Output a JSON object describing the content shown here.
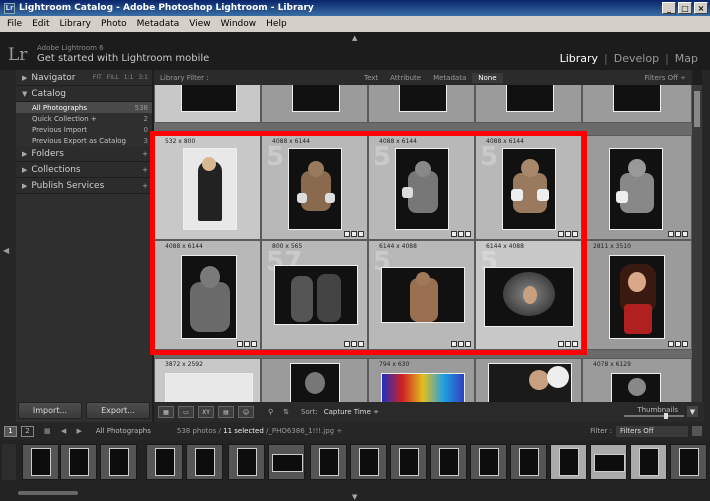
{
  "window": {
    "title": "Lightroom Catalog - Adobe Photoshop Lightroom - Library",
    "app_icon": "Lr",
    "min": "_",
    "max": "□",
    "close": "×"
  },
  "menu": [
    "File",
    "Edit",
    "Library",
    "Photo",
    "Metadata",
    "View",
    "Window",
    "Help"
  ],
  "identity": {
    "logo": "Lr",
    "brand": "Adobe Lightroom 6",
    "mobile": "Get started with Lightroom mobile"
  },
  "modules": {
    "library": "Library",
    "develop": "Develop",
    "map": "Map",
    "sep": "|"
  },
  "left_panel": {
    "navigator": {
      "label": "Navigator",
      "fit": "FIT",
      "fill": "FILL",
      "one": "1:1",
      "three": "3:1"
    },
    "catalog": {
      "label": "Catalog",
      "items": [
        {
          "label": "All Photographs",
          "count": "538"
        },
        {
          "label": "Quick Collection +",
          "count": "2"
        },
        {
          "label": "Previous Import",
          "count": "0"
        },
        {
          "label": "Previous Export as Catalog",
          "count": "3"
        }
      ]
    },
    "folders": "Folders",
    "collections": "Collections",
    "publish": "Publish Services",
    "plus": "+",
    "import": "Import...",
    "export": "Export..."
  },
  "filter_bar": {
    "label": "Library Filter :",
    "text": "Text",
    "attribute": "Attribute",
    "metadata": "Metadata",
    "none": "None",
    "filters_off": "Filters Off ÷"
  },
  "grid": {
    "row2": [
      {
        "dim": "532 x 800",
        "num": ""
      },
      {
        "dim": "4088 x 6144",
        "num": "5"
      },
      {
        "dim": "4088 x 6144",
        "num": "5"
      },
      {
        "dim": "4088 x 6144",
        "num": "5"
      },
      {
        "dim": "",
        "num": ""
      }
    ],
    "row3": [
      {
        "dim": "4088 x 6144",
        "num": ""
      },
      {
        "dim": "800 x 565",
        "num": "57"
      },
      {
        "dim": "6144 x 4088",
        "num": "5"
      },
      {
        "dim": "6144 x 4088",
        "num": "5"
      },
      {
        "dim": "2811 x 3510",
        "num": ""
      }
    ],
    "row4": [
      {
        "dim": "3872 x 2592",
        "num": ""
      },
      {
        "dim": "",
        "num": ""
      },
      {
        "dim": "794 x 630",
        "num": ""
      },
      {
        "dim": "",
        "num": ""
      },
      {
        "dim": "4078 x 6129",
        "num": ""
      }
    ]
  },
  "toolbar": {
    "sort_label": "Sort:",
    "sort_value": "Capture Time ÷",
    "thumbnails": "Thumbnails"
  },
  "filmstrip_bar": {
    "page1": "1",
    "page2": "2",
    "source": "All Photographs",
    "count_pre": "538 photos /",
    "count_sel": "11 selected",
    "filename": "/_PHO6386_1!!!.jpg ÷",
    "filter_label": "Filter :",
    "filter_value": "Filters Off"
  },
  "colors": {
    "selection_box": "#ff0000",
    "accent": "#ffffff"
  }
}
